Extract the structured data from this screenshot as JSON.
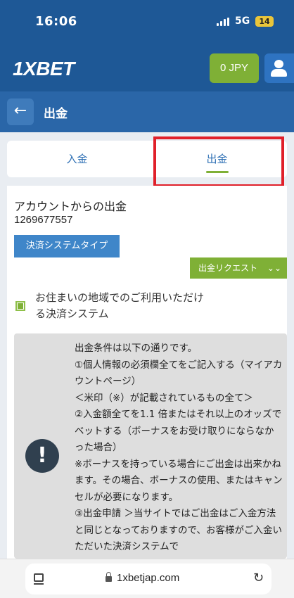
{
  "status_bar": {
    "time": "16:06",
    "network": "5G",
    "battery": "14"
  },
  "header": {
    "logo": "1XBET",
    "balance": "0 JPY",
    "icons": {
      "user": "user-icon"
    },
    "colors": {
      "brand": "#1e5896",
      "accent": "#7fb036"
    }
  },
  "page": {
    "title": "出金",
    "back_icon": "arrow-left-icon"
  },
  "tabs": [
    {
      "label": "入金",
      "active": false
    },
    {
      "label": "出金",
      "active": true
    }
  ],
  "account": {
    "title": "アカウントからの出金",
    "id": "1269677557"
  },
  "buttons": {
    "payment_system_type": "決済システムタイプ",
    "withdraw_request": "出金リクエスト"
  },
  "region_filter": {
    "checked": true,
    "label": "お住まいの地域でのご利用いただける決済システム"
  },
  "notice": {
    "icon": "exclamation-icon",
    "lines": [
      "出金条件は以下の通りです。",
      "①個人情報の必須欄全てをご記入する（マイアカウントページ）",
      "＜米印（※）が記載されているもの全て＞",
      "②入金額全てを1.1 倍またはそれ以上のオッズでベットする（ボーナスをお受け取りにならなかった場合）",
      "※ボーナスを持っている場合にご出金は出来かねます。その場合、ボーナスの使用、またはキャンセルが必要になります。",
      "③出金申請 ＞当サイトではご出金はご入金方法と同じとなっておりますので、お客様がご入金いただいた決済システムで"
    ]
  },
  "browser": {
    "url": "1xbetjap.com"
  }
}
